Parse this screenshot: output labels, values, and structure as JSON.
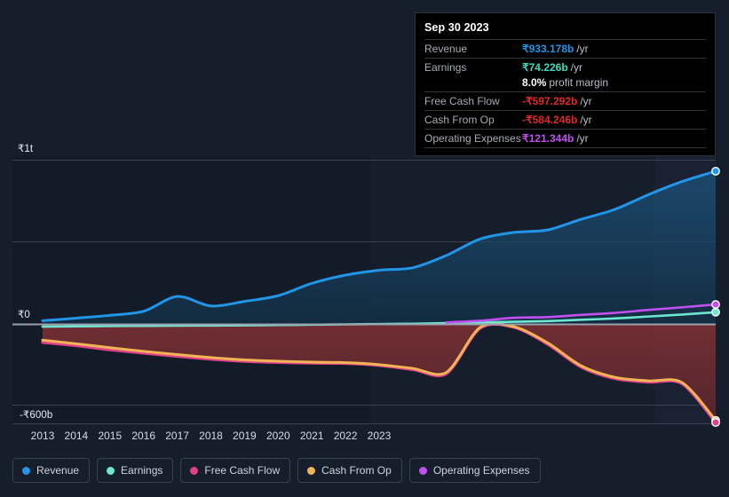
{
  "chart_data": {
    "type": "area",
    "title": "",
    "xlabel": "",
    "ylabel": "",
    "currency_symbol": "₹",
    "x": [
      2013,
      2014,
      2015,
      2016,
      2017,
      2018,
      2019,
      2020,
      2021,
      2022,
      2023
    ],
    "xtick_labels": [
      "2013",
      "2014",
      "2015",
      "2016",
      "2017",
      "2018",
      "2019",
      "2020",
      "2021",
      "2022",
      "2023"
    ],
    "ytick_labels": [
      "₹1t",
      "₹0",
      "-₹600b"
    ],
    "ytick_values": [
      1000,
      0,
      -600
    ],
    "ylim": [
      -640,
      1060
    ],
    "y_unit": "billions INR",
    "gridlines": [
      1000,
      500,
      0,
      -500
    ],
    "zero_line": 0,
    "grid": true,
    "legend_position": "bottom-left",
    "highlight_date": "Sep 30 2023",
    "series": [
      {
        "name": "Revenue",
        "color": "#2196e8",
        "fill": "#12354f",
        "values": [
          22,
          38,
          55,
          80,
          170,
          112,
          140,
          175,
          250,
          300,
          330,
          345,
          420,
          520,
          560,
          575,
          640,
          700,
          790,
          870,
          933.178
        ]
      },
      {
        "name": "Earnings",
        "color": "#6ee7d2",
        "fill": "none",
        "values": [
          -14,
          -12,
          -10,
          -9,
          -8,
          -7,
          -6,
          -4,
          -2,
          0,
          2,
          4,
          8,
          12,
          16,
          20,
          28,
          36,
          48,
          60,
          74.226
        ]
      },
      {
        "name": "Free Cash Flow",
        "color": "#e0408a",
        "fill": "none",
        "values": [
          -110,
          -130,
          -155,
          -175,
          -195,
          -212,
          -225,
          -232,
          -236,
          -238,
          -250,
          -275,
          -300,
          -24,
          -18,
          -120,
          -260,
          -330,
          -352,
          -362,
          -597.292
        ]
      },
      {
        "name": "Cash From Op",
        "color": "#f0b355",
        "fill": "#5c2a2e",
        "values": [
          -96,
          -118,
          -142,
          -164,
          -184,
          -202,
          -216,
          -224,
          -230,
          -233,
          -245,
          -268,
          -292,
          -18,
          -14,
          -112,
          -252,
          -322,
          -344,
          -354,
          -584.246
        ]
      },
      {
        "name": "Operating Expenses",
        "color": "#c24ff0",
        "fill": "none",
        "values": [
          null,
          null,
          null,
          null,
          null,
          null,
          null,
          null,
          null,
          null,
          null,
          null,
          12,
          22,
          40,
          44,
          58,
          70,
          88,
          104,
          121.344
        ]
      }
    ]
  },
  "tooltip": {
    "date": "Sep 30 2023",
    "rows": [
      {
        "label": "Revenue",
        "value": "₹933.178b",
        "unit": "/yr",
        "color": "#2196e8"
      },
      {
        "label": "Earnings",
        "value": "₹74.226b",
        "unit": "/yr",
        "color": "#3ddbbd"
      },
      {
        "label": "",
        "value": "8.0%",
        "unit": "profit margin",
        "color": "#ffffff"
      },
      {
        "label": "Free Cash Flow",
        "value": "-₹597.292b",
        "unit": "/yr",
        "color": "#e02a2a"
      },
      {
        "label": "Cash From Op",
        "value": "-₹584.246b",
        "unit": "/yr",
        "color": "#e02a2a"
      },
      {
        "label": "Operating Expenses",
        "value": "₹121.344b",
        "unit": "/yr",
        "color": "#c24ff0"
      }
    ]
  },
  "legend": {
    "items": [
      {
        "label": "Revenue",
        "color": "#2196e8"
      },
      {
        "label": "Earnings",
        "color": "#6ee7d2"
      },
      {
        "label": "Free Cash Flow",
        "color": "#e0408a"
      },
      {
        "label": "Cash From Op",
        "color": "#f0b355"
      },
      {
        "label": "Operating Expenses",
        "color": "#c24ff0"
      }
    ]
  },
  "axis": {
    "y_ticks": [
      {
        "label": "₹1t",
        "value": 1000
      },
      {
        "label": "₹0",
        "value": 0
      },
      {
        "label": "-₹600b",
        "value": -600
      }
    ],
    "x_ticks": [
      "2013",
      "2014",
      "2015",
      "2016",
      "2017",
      "2018",
      "2019",
      "2020",
      "2021",
      "2022",
      "2023"
    ]
  }
}
